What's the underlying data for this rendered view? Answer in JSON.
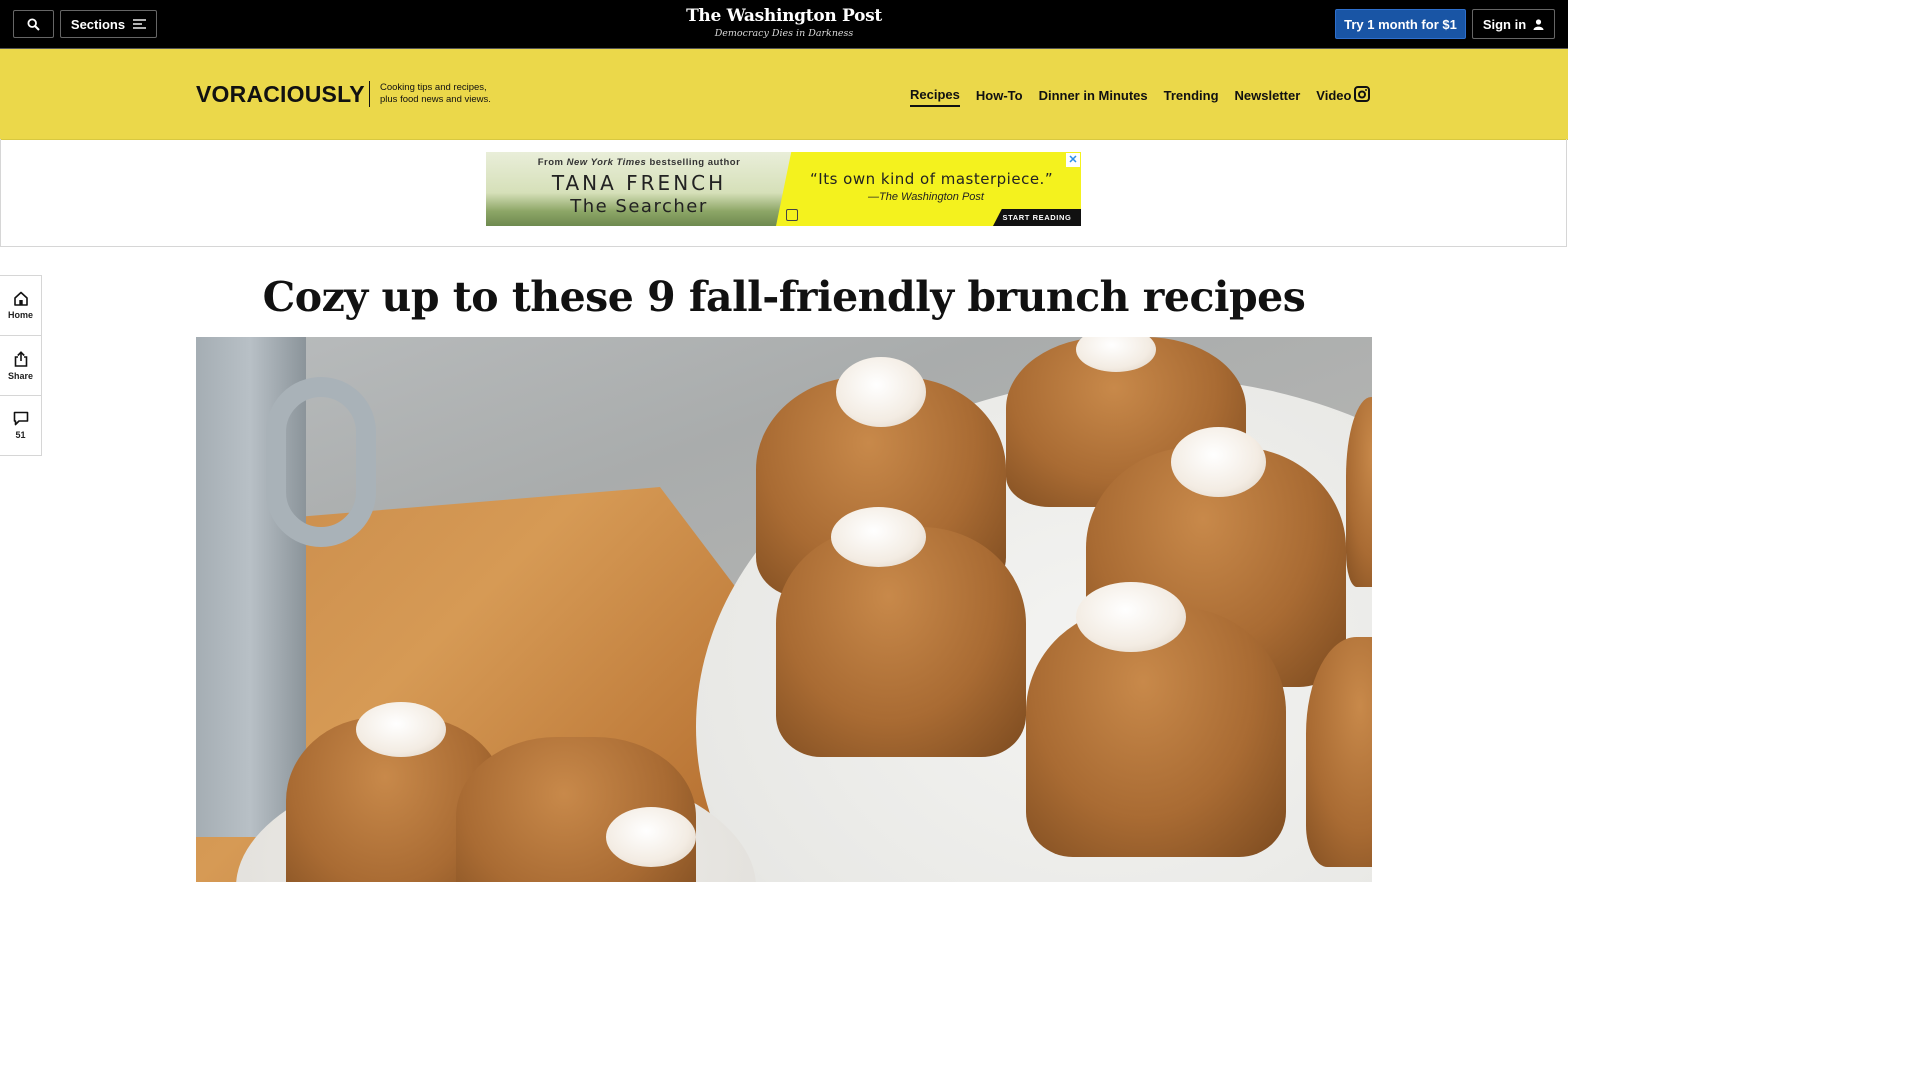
{
  "topbar": {
    "sections_label": "Sections",
    "masthead_name": "The Washington Post",
    "masthead_tagline": "Democracy Dies in Darkness",
    "subscribe_label": "Try 1 month for $1",
    "signin_label": "Sign in"
  },
  "header": {
    "logo_text": "VORACIOUSLY",
    "tagline_line1": "Cooking tips and recipes,",
    "tagline_line2": "plus food news and views.",
    "nav": [
      "Recipes",
      "How-To",
      "Dinner in Minutes",
      "Trending",
      "Newsletter",
      "Video"
    ],
    "active_nav": "Recipes"
  },
  "ad": {
    "from_prefix": "From",
    "from_publication": "New York Times",
    "from_suffix": "bestselling author",
    "author": "TANA FRENCH",
    "book": "The Searcher",
    "quote": "“Its own kind of masterpiece.”",
    "citation": "—The Washington Post",
    "cta": "START READING",
    "close": "✕"
  },
  "rail": {
    "home_label": "Home",
    "share_label": "Share",
    "comments_count": "51"
  },
  "article": {
    "headline": "Cozy up to these 9 fall-friendly brunch recipes"
  },
  "colors": {
    "brand_yellow": "#ebd84a",
    "subscribe_blue": "#1955a5",
    "topbar_black": "#000000"
  }
}
